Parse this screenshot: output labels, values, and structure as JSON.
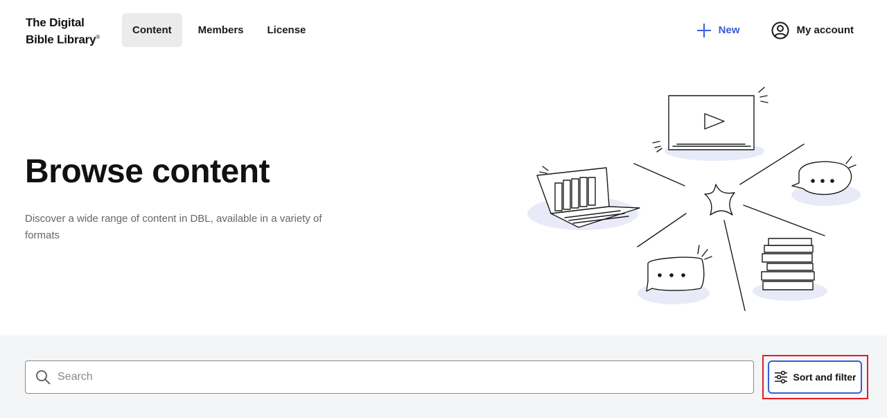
{
  "header": {
    "logo_line1": "The Digital",
    "logo_line2": "Bible Library",
    "logo_mark": "®",
    "nav": [
      {
        "label": "Content",
        "active": true
      },
      {
        "label": "Members",
        "active": false
      },
      {
        "label": "License",
        "active": false
      }
    ],
    "new_label": "New",
    "new_icon": "plus-icon",
    "account_label": "My account",
    "account_icon": "user-circle-icon"
  },
  "hero": {
    "title": "Browse content",
    "description": "Discover a wide range of content in DBL, available in a variety of formats"
  },
  "toolbar": {
    "search_placeholder": "Search",
    "search_value": "",
    "search_icon": "search-icon",
    "filter_label": "Sort and filter",
    "filter_icon": "sliders-icon"
  },
  "colors": {
    "accent": "#3b5bdb",
    "highlight": "#e01b24",
    "band": "#f4f5f7",
    "active_nav": "#ebebeb"
  }
}
